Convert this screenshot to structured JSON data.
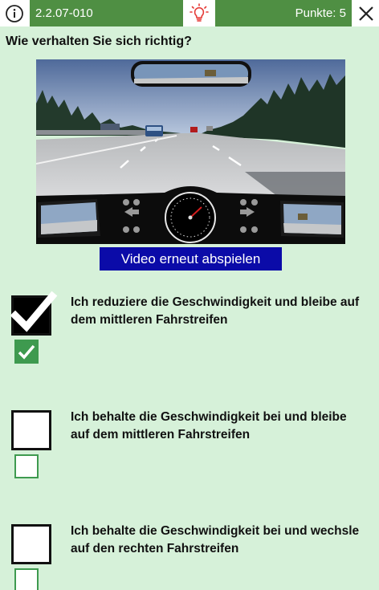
{
  "topbar": {
    "question_id": "2.2.07-010",
    "score_text": "Punkte: 5",
    "info_icon": "info-circle-icon",
    "hint_icon": "lightbulb-icon",
    "close_icon": "close-icon"
  },
  "question": {
    "text": "Wie verhalten Sie sich richtig?"
  },
  "media": {
    "replay_label": "Video erneut abspielen"
  },
  "answers": [
    {
      "text": "Ich reduziere die Geschwindigkeit und bleibe auf dem mittleren Fahrstreifen",
      "selected": true,
      "correct": true
    },
    {
      "text": "Ich behalte die Geschwindigkeit bei und bleibe auf dem mittleren Fahrstreifen",
      "selected": false,
      "correct": false
    },
    {
      "text": "Ich behalte die Geschwindigkeit bei und wechsle auf den rechten Fahrstreifen",
      "selected": false,
      "correct": false
    }
  ],
  "colors": {
    "bar_green": "#4f8f43",
    "background": "#d6f1d9",
    "check_green": "#3e9a4f",
    "button_blue": "#0b0ba8",
    "hint_red": "#e53935"
  }
}
